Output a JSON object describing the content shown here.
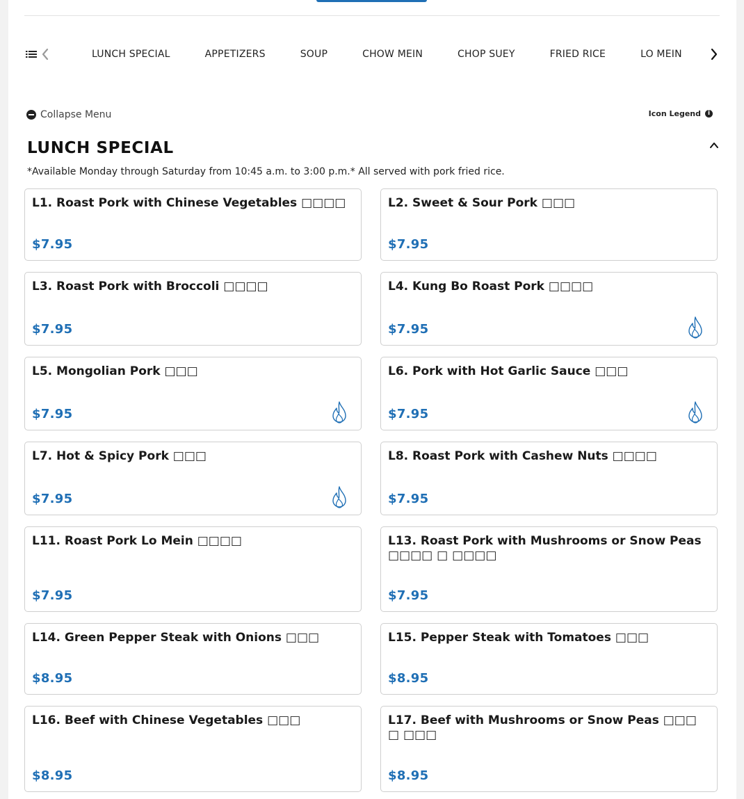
{
  "nav": {
    "tabs": [
      "LUNCH SPECIAL",
      "APPETIZERS",
      "SOUP",
      "CHOW MEIN",
      "CHOP SUEY",
      "FRIED RICE",
      "LO MEIN"
    ]
  },
  "controls": {
    "collapse_label": "Collapse Menu",
    "legend_label": "Icon Legend"
  },
  "section": {
    "title": "LUNCH SPECIAL",
    "note": "*Available Monday through Saturday from 10:45 a.m. to 3:00 p.m.* All served with pork fried rice."
  },
  "items": [
    {
      "name": "L1. Roast Pork with Chinese Vegetables □□□□",
      "price": "$7.95",
      "spicy": false
    },
    {
      "name": "L2. Sweet & Sour Pork □□□",
      "price": "$7.95",
      "spicy": false
    },
    {
      "name": "L3. Roast Pork with Broccoli □□□□",
      "price": "$7.95",
      "spicy": false
    },
    {
      "name": "L4. Kung Bo Roast Pork □□□□",
      "price": "$7.95",
      "spicy": true
    },
    {
      "name": "L5. Mongolian Pork □□□",
      "price": "$7.95",
      "spicy": true
    },
    {
      "name": "L6. Pork with Hot Garlic Sauce □□□",
      "price": "$7.95",
      "spicy": true
    },
    {
      "name": "L7. Hot & Spicy Pork □□□",
      "price": "$7.95",
      "spicy": true
    },
    {
      "name": "L8. Roast Pork with Cashew Nuts □□□□",
      "price": "$7.95",
      "spicy": false
    },
    {
      "name": "L11. Roast Pork Lo Mein □□□□",
      "price": "$7.95",
      "spicy": false
    },
    {
      "name": "L13. Roast Pork with Mushrooms or Snow Peas □□□□ □ □□□□",
      "price": "$7.95",
      "spicy": false
    },
    {
      "name": "L14. Green Pepper Steak with Onions □□□",
      "price": "$8.95",
      "spicy": false
    },
    {
      "name": "L15. Pepper Steak with Tomatoes □□□",
      "price": "$8.95",
      "spicy": false
    },
    {
      "name": "L16. Beef with Chinese Vegetables □□□",
      "price": "$8.95",
      "spicy": false
    },
    {
      "name": "L17. Beef with Mushrooms or Snow Peas □□□ □ □□□",
      "price": "$8.95",
      "spicy": false
    }
  ],
  "colors": {
    "accent": "#1f6fb5",
    "border": "#cfcfcf"
  },
  "icons": {
    "menu_list": "list-icon",
    "prev": "chevron-left-icon",
    "next": "chevron-right-icon",
    "collapse": "minus-circle-icon",
    "legend": "info-icon",
    "section_toggle": "chevron-up-icon",
    "spicy": "flame-icon"
  }
}
